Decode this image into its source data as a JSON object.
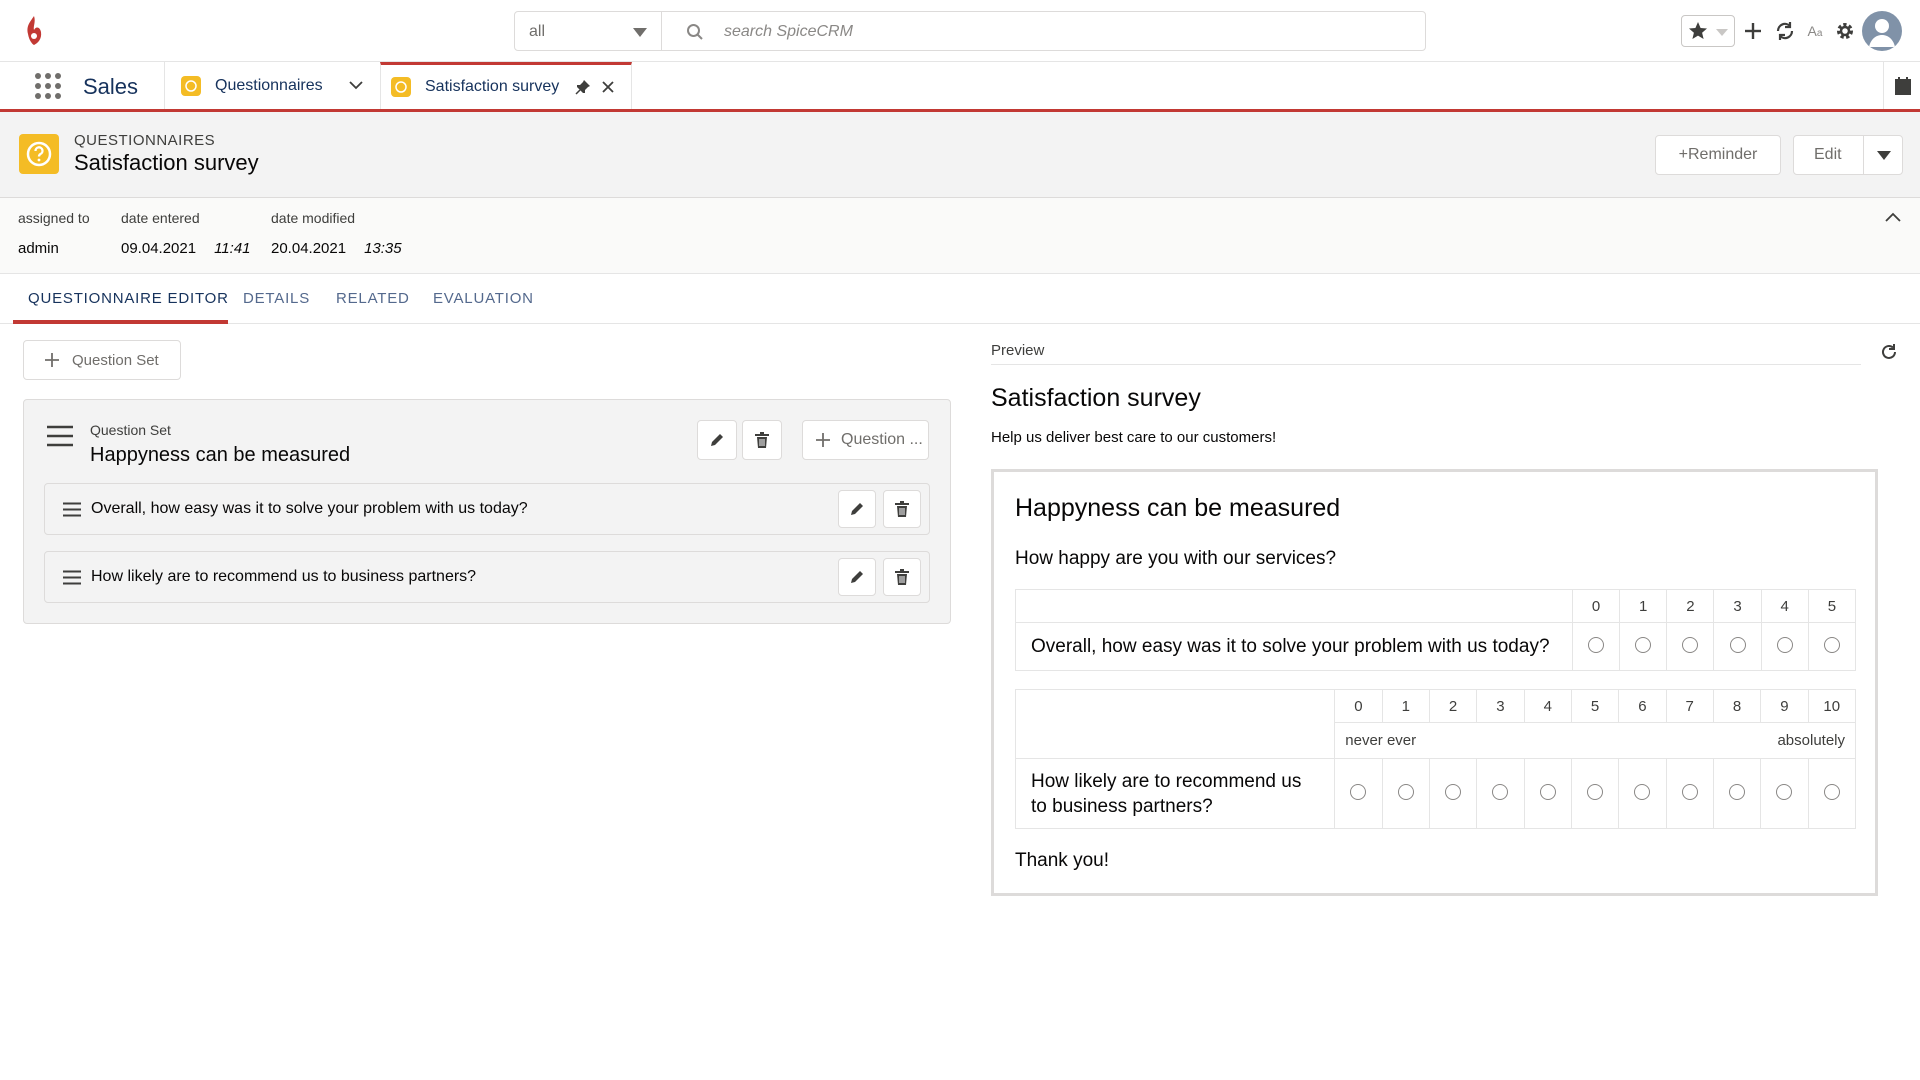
{
  "topbar": {
    "scope_value": "all",
    "search_placeholder": "search SpiceCRM"
  },
  "nav": {
    "app_name": "Sales",
    "tabs": [
      {
        "label": "Questionnaires"
      },
      {
        "label": "Satisfaction survey"
      }
    ]
  },
  "header": {
    "module": "QUESTIONNAIRES",
    "title": "Satisfaction survey",
    "reminder_label": "+Reminder",
    "edit_label": "Edit"
  },
  "fields": {
    "assigned_label": "assigned to",
    "assigned_value": "admin",
    "entered_label": "date entered",
    "entered_date": "09.04.2021",
    "entered_time": "11:41",
    "modified_label": "date modified",
    "modified_date": "20.04.2021",
    "modified_time": "13:35"
  },
  "tabs": [
    {
      "label": "QUESTIONNAIRE EDITOR"
    },
    {
      "label": "DETAILS"
    },
    {
      "label": "RELATED"
    },
    {
      "label": "EVALUATION"
    }
  ],
  "editor": {
    "add_set_label": "Question Set",
    "set_label": "Question Set",
    "set_name": "Happyness can be measured",
    "add_question_label": "Question ...",
    "questions": [
      {
        "text": "Overall, how easy was it to solve your problem with us today?"
      },
      {
        "text": "How likely are to recommend us to business partners?"
      }
    ]
  },
  "preview": {
    "label": "Preview",
    "title": "Satisfaction survey",
    "subtitle": "Help us deliver best care to our customers!",
    "set_name": "Happyness can be measured",
    "set_question": "How happy are you with our services?",
    "q1": {
      "text": "Overall, how easy was it to solve your problem with us today?",
      "scale": [
        "0",
        "1",
        "2",
        "3",
        "4",
        "5"
      ]
    },
    "q2": {
      "text": "How likely are to recommend us to business partners?",
      "scale": [
        "0",
        "1",
        "2",
        "3",
        "4",
        "5",
        "6",
        "7",
        "8",
        "9",
        "10"
      ],
      "min_label": "never ever",
      "max_label": "absolutely"
    },
    "thanks": "Thank you!"
  }
}
